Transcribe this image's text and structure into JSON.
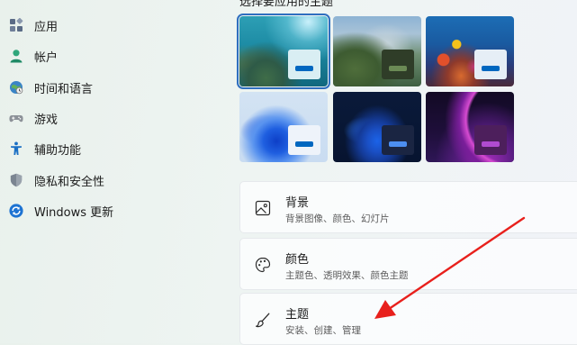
{
  "sidebar": {
    "items": [
      {
        "label": "应用",
        "icon": "apps-icon"
      },
      {
        "label": "帐户",
        "icon": "account-icon"
      },
      {
        "label": "时间和语言",
        "icon": "time-language-icon"
      },
      {
        "label": "游戏",
        "icon": "gaming-icon"
      },
      {
        "label": "辅助功能",
        "icon": "accessibility-icon"
      },
      {
        "label": "隐私和安全性",
        "icon": "privacy-shield-icon"
      },
      {
        "label": "Windows 更新",
        "icon": "windows-update-icon"
      }
    ]
  },
  "themes": {
    "header": "选择要应用的主题",
    "selected_index": 0,
    "items": [
      {
        "name": "underwater"
      },
      {
        "name": "mountain-lake"
      },
      {
        "name": "coral-reef"
      },
      {
        "name": "bloom-light"
      },
      {
        "name": "bloom-dark"
      },
      {
        "name": "glow"
      }
    ]
  },
  "cards": [
    {
      "title": "背景",
      "desc": "背景图像、颜色、幻灯片",
      "icon": "image-icon"
    },
    {
      "title": "颜色",
      "desc": "主题色、透明效果、颜色主题",
      "icon": "palette-icon"
    },
    {
      "title": "主题",
      "desc": "安装、创建、管理",
      "icon": "brush-icon"
    }
  ],
  "colors": {
    "accent": "#0067c0",
    "annotation_arrow": "#e8201c"
  }
}
